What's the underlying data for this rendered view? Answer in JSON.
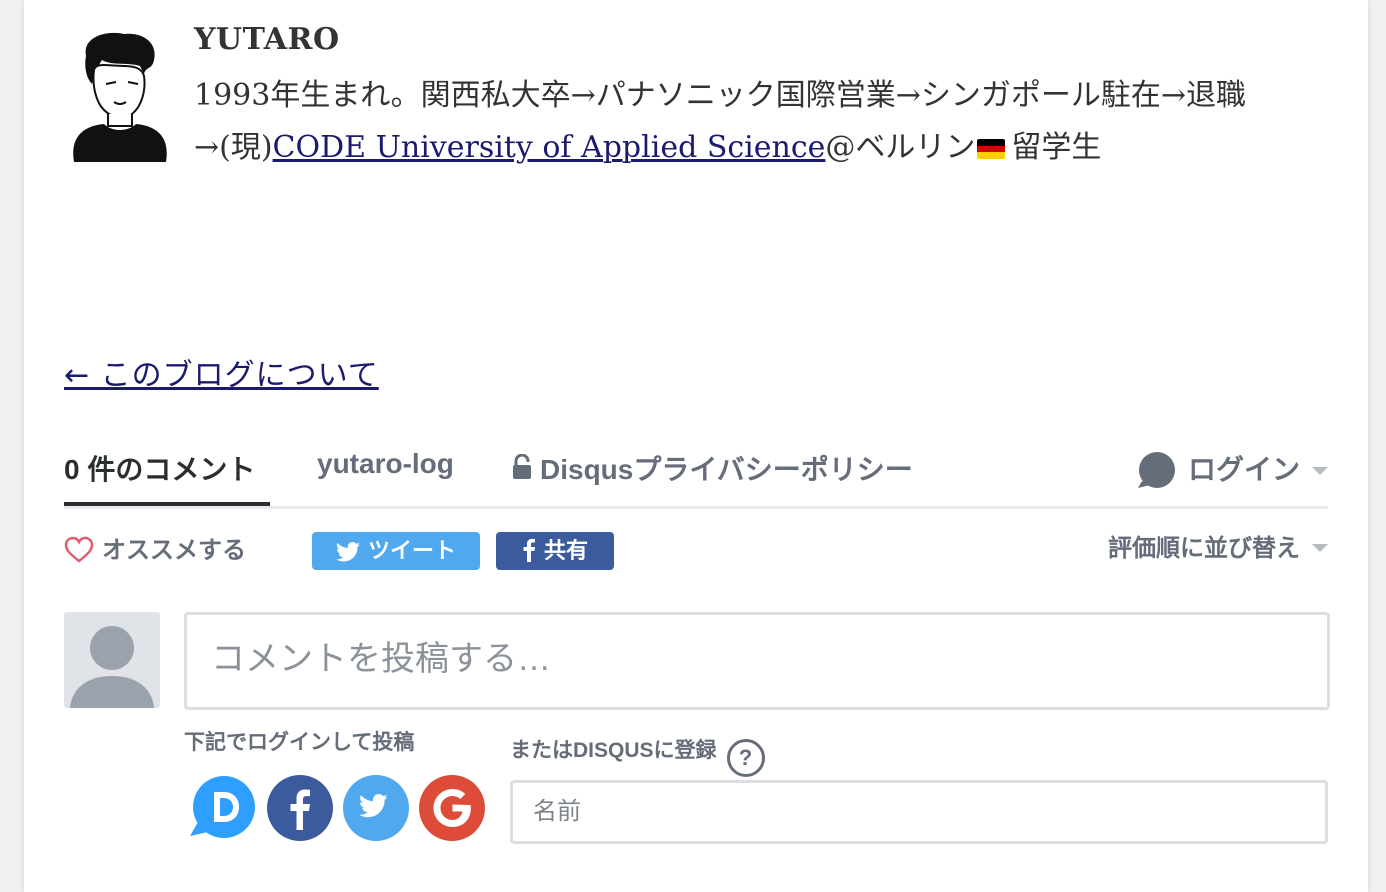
{
  "author": {
    "name": "YUTARO",
    "bio_prefix": "1993年生まれ。関西私大卒→パナソニック国際営業→シンガポール駐在→退職→(現)",
    "bio_link": "CODE University of Applied Science",
    "bio_suffix_at": "@ベルリン",
    "bio_suffix": "留学生"
  },
  "back_link": "← このブログについて",
  "disqus": {
    "nav": {
      "comments": "0 件のコメント",
      "community": "yutaro-log",
      "privacy": "Disqusプライバシーポリシー",
      "login": "ログイン"
    },
    "actions": {
      "recommend": "オススメする",
      "tweet": "ツイート",
      "share": "共有",
      "sort": "評価順に並び替え"
    },
    "composer": {
      "placeholder": "コメントを投稿する…",
      "login_label": "下記でログインして投稿",
      "signup_label": "またはDISQUSに登録",
      "help": "?",
      "name_placeholder": "名前"
    },
    "social_icons": [
      "disqus-icon",
      "facebook-icon",
      "twitter-icon",
      "google-icon"
    ]
  },
  "colors": {
    "link": "#1a1a6e",
    "tweet": "#50a9ef",
    "facebook": "#3b5b9c",
    "disqus": "#2e9fff",
    "google": "#dd4b39",
    "muted": "#656c7a"
  }
}
